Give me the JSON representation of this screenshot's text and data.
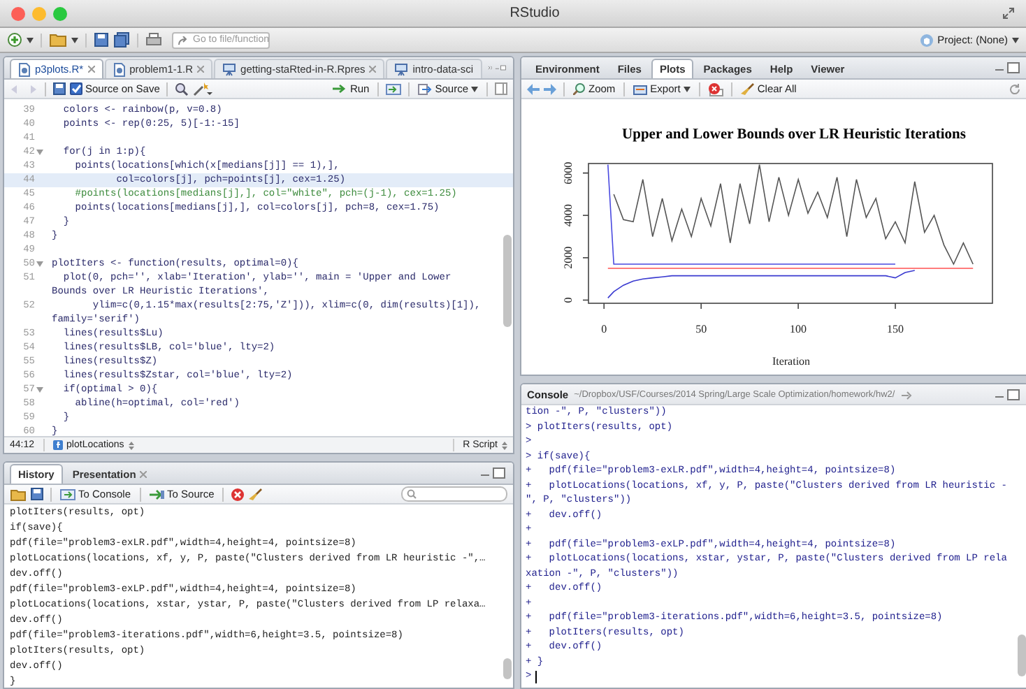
{
  "window": {
    "title": "RStudio"
  },
  "toolbar": {
    "search": {
      "placeholder": "Go to file/function"
    },
    "project": "Project: (None)"
  },
  "editor": {
    "tabs": [
      {
        "label": "p3plots.R*",
        "selected": true,
        "kind": "script",
        "closable": true
      },
      {
        "label": "problem1-1.R",
        "selected": false,
        "kind": "script",
        "closable": true
      },
      {
        "label": "getting-staRted-in-R.Rpres",
        "selected": false,
        "kind": "presentation",
        "closable": true
      },
      {
        "label": "intro-data-sci",
        "selected": false,
        "kind": "presentation",
        "closable": false
      }
    ],
    "toolbar": {
      "source_on_save": {
        "label": "Source on Save",
        "checked": true
      },
      "run": "Run",
      "source": "Source"
    },
    "lines": [
      {
        "number": "39",
        "text": "  colors <- rainbow(p, v=0.8)",
        "kind": "code",
        "fold": false,
        "highlighted": false
      },
      {
        "number": "40",
        "text": "  points <- rep(0:25, 5)[-1:-15]",
        "kind": "code",
        "fold": false,
        "highlighted": false
      },
      {
        "number": "41",
        "fold": false,
        "highlighted": false
      },
      {
        "number": "42",
        "text": "  for(j in 1:p){",
        "kind": "code",
        "fold": true,
        "highlighted": false
      },
      {
        "number": "43",
        "text": "    points(locations[which(x[medians[j]] == 1),],",
        "kind": "code",
        "fold": false,
        "highlighted": false
      },
      {
        "number": "44",
        "text": "           col=colors[j], pch=points[j], cex=1.25)",
        "kind": "code",
        "fold": false,
        "highlighted": true
      },
      {
        "number": "45",
        "text": "    #points(locations[medians[j],], col=\"white\", pch=(j-1), cex=1.25)",
        "kind": "comment",
        "fold": false,
        "highlighted": false
      },
      {
        "number": "46",
        "text": "    points(locations[medians[j],], col=colors[j], pch=8, cex=1.75)",
        "kind": "code",
        "fold": false,
        "highlighted": false
      },
      {
        "number": "47",
        "text": "  }",
        "kind": "code",
        "fold": false,
        "highlighted": false
      },
      {
        "number": "48",
        "text": "}",
        "kind": "code",
        "fold": false,
        "highlighted": false
      },
      {
        "number": "49",
        "fold": false,
        "highlighted": false
      },
      {
        "number": "50",
        "text": "plotIters <- function(results, optimal=0){",
        "kind": "code",
        "fold": true,
        "highlighted": false
      },
      {
        "number": "51",
        "text": "  plot(0, pch='', xlab='Iteration', ylab='', main = 'Upper and Lower",
        "kind": "code",
        "fold": false,
        "highlighted": false
      },
      {
        "text": "Bounds over LR Heuristic Iterations',",
        "kind": "code",
        "fold": false,
        "highlighted": false
      },
      {
        "number": "52",
        "text": "       ylim=c(0,1.15*max(results[2:75,'Z'])), xlim=c(0, dim(results)[1]),",
        "kind": "code",
        "fold": false,
        "highlighted": false
      },
      {
        "text": "family='serif')",
        "kind": "code",
        "fold": false,
        "highlighted": false
      },
      {
        "number": "53",
        "text": "  lines(results$Lu)",
        "kind": "code",
        "fold": false,
        "highlighted": false
      },
      {
        "number": "54",
        "text": "  lines(results$LB, col='blue', lty=2)",
        "kind": "code",
        "fold": false,
        "highlighted": false
      },
      {
        "number": "55",
        "text": "  lines(results$Z)",
        "kind": "code",
        "fold": false,
        "highlighted": false
      },
      {
        "number": "56",
        "text": "  lines(results$Zstar, col='blue', lty=2)",
        "kind": "code",
        "fold": false,
        "highlighted": false
      },
      {
        "number": "57",
        "text": "  if(optimal > 0){",
        "kind": "code",
        "fold": true,
        "highlighted": false
      },
      {
        "number": "58",
        "text": "    abline(h=optimal, col='red')",
        "kind": "code",
        "fold": false,
        "highlighted": false
      },
      {
        "number": "59",
        "text": "  }",
        "kind": "code",
        "fold": false,
        "highlighted": false
      },
      {
        "number": "60",
        "text": "}",
        "kind": "code",
        "fold": false,
        "highlighted": false
      }
    ],
    "status": {
      "position": "44:12",
      "function": "plotLocations",
      "file_type": "R Script"
    }
  },
  "history": {
    "tabs": [
      {
        "label": "History",
        "selected": true,
        "closable": false
      },
      {
        "label": "Presentation",
        "selected": false,
        "closable": true
      }
    ],
    "toolbar": {
      "to_console": "To Console",
      "to_source": "To Source"
    },
    "lines": [
      "plotIters(results, opt)",
      "if(save){",
      "pdf(file=\"problem3-exLR.pdf\",width=4,height=4, pointsize=8)",
      "plotLocations(locations, xf, y, P, paste(\"Clusters derived from LR heuristic -\",…",
      "dev.off()",
      "pdf(file=\"problem3-exLP.pdf\",width=4,height=4, pointsize=8)",
      "plotLocations(locations, xstar, ystar, P, paste(\"Clusters derived from LP relaxa…",
      "dev.off()",
      "pdf(file=\"problem3-iterations.pdf\",width=6,height=3.5, pointsize=8)",
      "plotIters(results, opt)",
      "dev.off()",
      "}"
    ]
  },
  "plots": {
    "tabs": [
      {
        "label": "Environment",
        "selected": false
      },
      {
        "label": "Files",
        "selected": false
      },
      {
        "label": "Plots",
        "selected": true
      },
      {
        "label": "Packages",
        "selected": false
      },
      {
        "label": "Help",
        "selected": false
      },
      {
        "label": "Viewer",
        "selected": false
      }
    ],
    "toolbar": {
      "zoom": "Zoom",
      "export": "Export",
      "clear": "Clear All"
    },
    "chart_data": {
      "type": "line",
      "title": "Upper and Lower Bounds over LR Heuristic Iterations",
      "xlabel": "Iteration",
      "x": [
        2,
        5,
        10,
        15,
        20,
        25,
        30,
        35,
        40,
        45,
        50,
        55,
        60,
        65,
        70,
        75,
        80,
        85,
        90,
        95,
        100,
        105,
        110,
        115,
        120,
        125,
        130,
        135,
        140,
        145,
        150,
        155,
        160,
        165,
        170,
        175,
        180,
        185,
        190
      ],
      "series": [
        {
          "color": "#555555",
          "values": [
            null,
            5000,
            3800,
            3700,
            5700,
            3000,
            4800,
            2800,
            4300,
            3000,
            4800,
            3500,
            5500,
            2700,
            5500,
            3600,
            6400,
            3700,
            5800,
            4000,
            5700,
            4100,
            5100,
            3900,
            5800,
            3000,
            5700,
            3900,
            4800,
            2900,
            3700,
            2700,
            5600,
            3200,
            4000,
            2600,
            1700,
            2700,
            1700
          ]
        },
        {
          "color": "#4a4ae0",
          "values": [
            6400,
            1700,
            1700,
            1700,
            1700,
            1700,
            1700,
            1700,
            1700,
            1700,
            1700,
            1700,
            1700,
            1700,
            1700,
            1700,
            1700,
            1700,
            1700,
            1700,
            1700,
            1700,
            1700,
            1700,
            1700,
            1700,
            1700,
            1700,
            1700,
            1700,
            1700,
            null,
            null,
            null,
            null,
            null,
            null,
            null,
            null
          ]
        },
        {
          "color": "#3a3ad0",
          "values": [
            100,
            400,
            700,
            900,
            1000,
            1050,
            1100,
            1150,
            1150,
            1150,
            1150,
            1150,
            1150,
            1150,
            1150,
            1150,
            1150,
            1150,
            1150,
            1150,
            1150,
            1150,
            1150,
            1150,
            1150,
            1150,
            1150,
            1150,
            1150,
            1150,
            1050,
            1300,
            1400,
            null,
            null,
            null,
            null,
            null,
            null
          ]
        },
        {
          "color": "#ff5050",
          "values": [
            1500,
            1500,
            1500,
            1500,
            1500,
            1500,
            1500,
            1500,
            1500,
            1500,
            1500,
            1500,
            1500,
            1500,
            1500,
            1500,
            1500,
            1500,
            1500,
            1500,
            1500,
            1500,
            1500,
            1500,
            1500,
            1500,
            1500,
            1500,
            1500,
            1500,
            1500,
            1500,
            1500,
            1500,
            1500,
            1500,
            1500,
            1500,
            1500
          ]
        }
      ],
      "xlim": [
        -8,
        200
      ],
      "ylim": [
        -150,
        6450
      ],
      "xticks": [
        0,
        50,
        100,
        150
      ],
      "yticks": [
        0,
        2000,
        4000,
        6000
      ]
    }
  },
  "console": {
    "title": "Console",
    "path": "~/Dropbox/USF/Courses/2014 Spring/Large Scale Optimization/homework/hw2/",
    "caret": true,
    "lines": [
      "tion -\", P, \"clusters\"))",
      "> plotIters(results, opt)",
      ">",
      "> if(save){",
      "+   pdf(file=\"problem3-exLR.pdf\",width=4,height=4, pointsize=8)",
      "+   plotLocations(locations, xf, y, P, paste(\"Clusters derived from LR heuristic -",
      "\", P, \"clusters\"))",
      "+   dev.off()",
      "+",
      "+   pdf(file=\"problem3-exLP.pdf\",width=4,height=4, pointsize=8)",
      "+   plotLocations(locations, xstar, ystar, P, paste(\"Clusters derived from LP rela",
      "xation -\", P, \"clusters\"))",
      "+   dev.off()",
      "+",
      "+   pdf(file=\"problem3-iterations.pdf\",width=6,height=3.5, pointsize=8)",
      "+   plotIters(results, opt)",
      "+   dev.off()",
      "+ }",
      ">"
    ]
  }
}
